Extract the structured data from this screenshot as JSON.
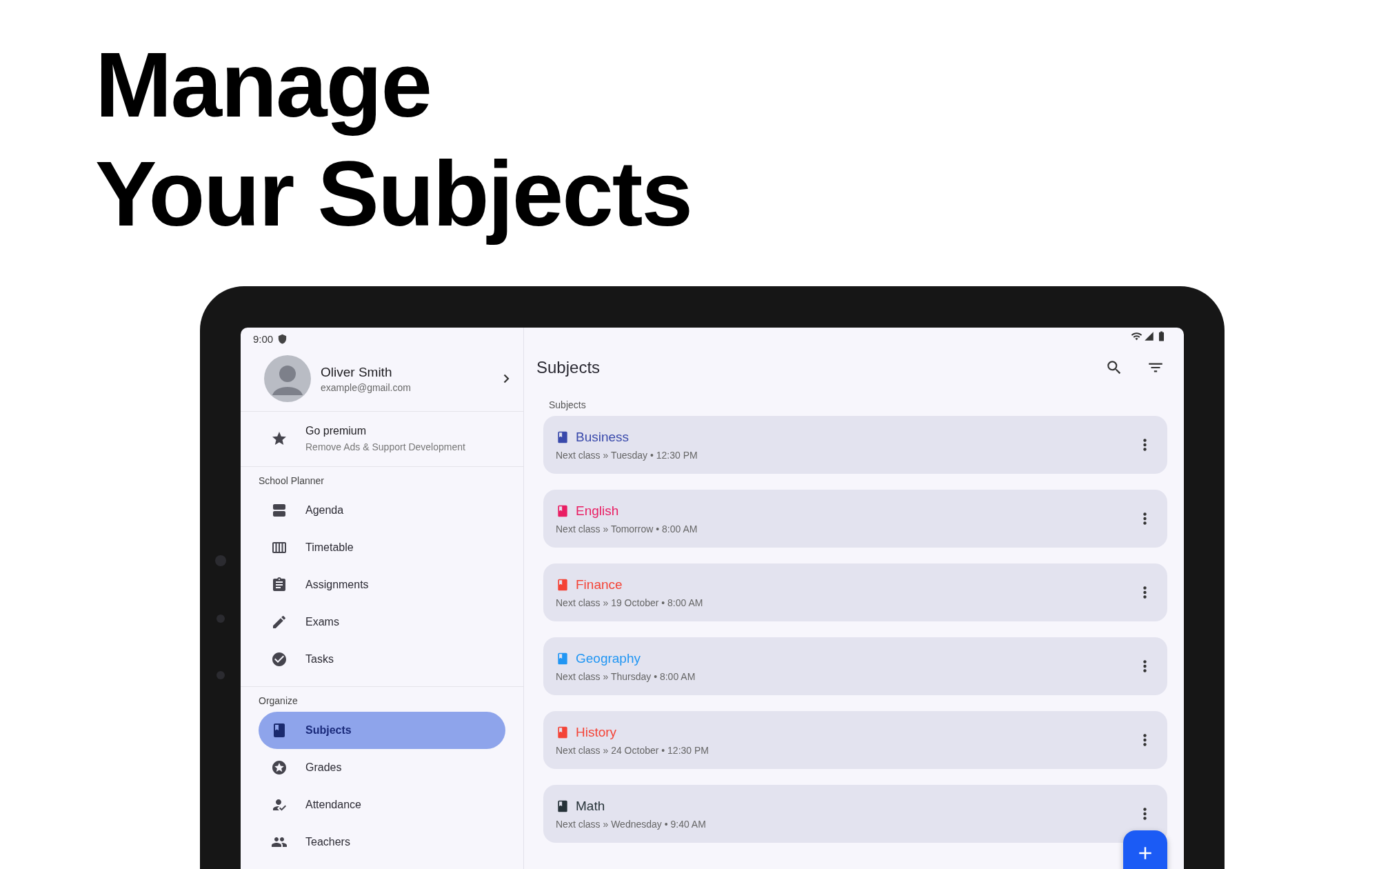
{
  "headline": [
    "Manage",
    "Your Subjects"
  ],
  "status_bar": {
    "time": "9:00"
  },
  "profile": {
    "name": "Oliver Smith",
    "email": "example@gmail.com"
  },
  "premium": {
    "title": "Go premium",
    "subtitle": "Remove Ads & Support Development"
  },
  "nav_sections": [
    {
      "title": "School Planner",
      "items": [
        {
          "label": "Agenda",
          "selected": false
        },
        {
          "label": "Timetable",
          "selected": false
        },
        {
          "label": "Assignments",
          "selected": false
        },
        {
          "label": "Exams",
          "selected": false
        },
        {
          "label": "Tasks",
          "selected": false
        }
      ]
    },
    {
      "title": "Organize",
      "items": [
        {
          "label": "Subjects",
          "selected": true
        },
        {
          "label": "Grades",
          "selected": false
        },
        {
          "label": "Attendance",
          "selected": false
        },
        {
          "label": "Teachers",
          "selected": false
        }
      ]
    }
  ],
  "app_bar": {
    "title": "Subjects"
  },
  "list": {
    "header": "Subjects",
    "subjects": [
      {
        "name": "Business",
        "next_class": "Next class » Tuesday • 12:30 PM",
        "color": "#3949ab"
      },
      {
        "name": "English",
        "next_class": "Next class » Tomorrow • 8:00 AM",
        "color": "#e91e63"
      },
      {
        "name": "Finance",
        "next_class": "Next class » 19 October • 8:00 AM",
        "color": "#f44336"
      },
      {
        "name": "Geography",
        "next_class": "Next class » Thursday • 8:00 AM",
        "color": "#2196f3"
      },
      {
        "name": "History",
        "next_class": "Next class » 24 October • 12:30 PM",
        "color": "#f44336"
      },
      {
        "name": "Math",
        "next_class": "Next class » Wednesday • 9:40 AM",
        "color": "#263238"
      }
    ]
  }
}
